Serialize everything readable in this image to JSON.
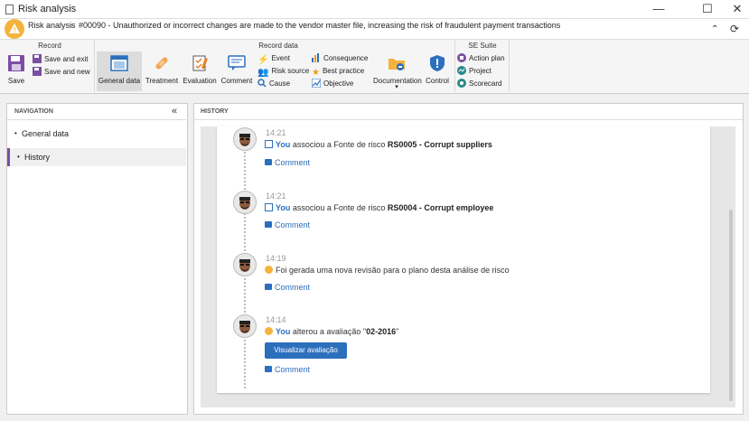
{
  "window": {
    "title": "Risk analysis",
    "minimize": "—",
    "maximize": "☐",
    "close": "✕"
  },
  "breadcrumb": {
    "root": "Risk analysis",
    "sep": "›",
    "current": "#00090 - Unauthorized or incorrect changes are made to the vendor master file, increasing the risk of fraudulent payment transactions"
  },
  "ribbon": {
    "record": {
      "label": "Record",
      "save": "Save",
      "save_exit": "Save and exit",
      "save_new": "Save and new"
    },
    "record_data": {
      "label": "Record data",
      "general_data": "General data",
      "treatment": "Treatment",
      "evaluation": "Evaluation",
      "comment": "Comment",
      "event": "Event",
      "risk_source": "Risk source",
      "cause": "Cause",
      "consequence": "Consequence",
      "best_practice": "Best practice",
      "objective": "Objective",
      "documentation": "Documentation",
      "control": "Control"
    },
    "se_suite": {
      "label": "SE Suite",
      "action_plan": "Action plan",
      "project": "Project",
      "scorecard": "Scorecard"
    }
  },
  "navigation": {
    "header": "NAVIGATION",
    "items": [
      {
        "label": "General data"
      },
      {
        "label": "History"
      }
    ]
  },
  "history": {
    "header": "HISTORY",
    "entries": [
      {
        "time": "14:21",
        "actor": "You",
        "text": " associou a Fonte de risco ",
        "bold": "RS0005 - Corrupt suppliers",
        "comment": "Comment"
      },
      {
        "time": "14:21",
        "actor": "You",
        "text": " associou a Fonte de risco ",
        "bold": "RS0004 - Corrupt employee",
        "comment": "Comment"
      },
      {
        "time": "14:19",
        "text": "Foi gerada uma nova revisão para o plano desta análise de risco",
        "comment": "Comment"
      },
      {
        "time": "14:14",
        "actor": "You",
        "text": " alterou a avaliação \"",
        "bold": "02-2016",
        "tail": "\"",
        "button": "Visualizar avaliação",
        "comment": "Comment"
      }
    ]
  },
  "colors": {
    "accent": "#2c6fbd",
    "warning": "#f3b33d",
    "active_nav": "#7b4ea3"
  }
}
